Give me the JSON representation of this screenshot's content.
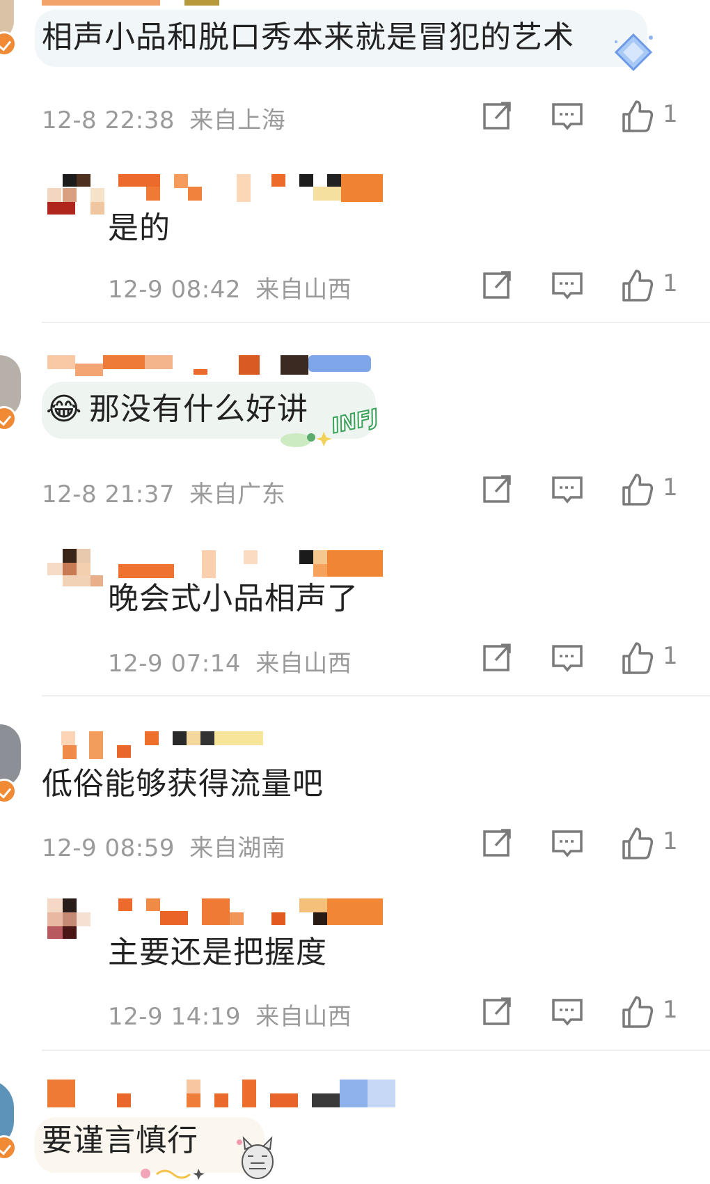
{
  "comments": [
    {
      "text": "相声小品和脱口秀本来就是冒犯的艺术",
      "date": "12-8 22:38",
      "location": "来自上海",
      "likes": "1",
      "replies": [
        {
          "text": "是的",
          "date": "12-9 08:42",
          "location": "来自山西",
          "likes": "1"
        }
      ]
    },
    {
      "text": "那没有什么好讲",
      "emoji": "😂",
      "badge_text": "INFJ",
      "date": "12-8 21:37",
      "location": "来自广东",
      "likes": "1",
      "replies": [
        {
          "text": "晚会式小品相声了",
          "date": "12-9 07:14",
          "location": "来自山西",
          "likes": "1"
        }
      ]
    },
    {
      "text": "低俗能够获得流量吧",
      "date": "12-9 08:59",
      "location": "来自湖南",
      "likes": "1",
      "replies": [
        {
          "text": "主要还是把握度",
          "date": "12-9 14:19",
          "location": "来自山西",
          "likes": "1"
        }
      ]
    },
    {
      "text": "要谨言慎行"
    }
  ],
  "icons": {
    "share": "share-icon",
    "comment": "comment-icon",
    "like": "thumbs-up-icon"
  },
  "colors": {
    "meta_text": "#9a9a9a",
    "badge": "#f08a34",
    "icon_stroke": "#7a7a7a"
  }
}
